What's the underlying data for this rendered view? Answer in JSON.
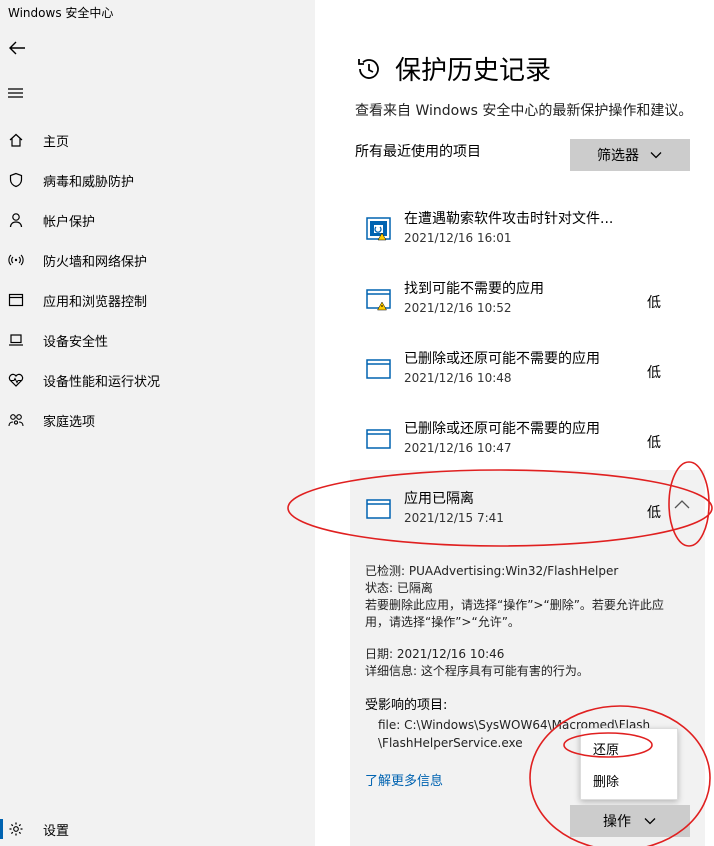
{
  "window": {
    "title": "Windows 安全中心"
  },
  "sidebar": {
    "items": [
      {
        "label": "主页",
        "icon": "home-icon"
      },
      {
        "label": "病毒和威胁防护",
        "icon": "shield-icon"
      },
      {
        "label": "帐户保护",
        "icon": "person-icon"
      },
      {
        "label": "防火墙和网络保护",
        "icon": "wifi-icon"
      },
      {
        "label": "应用和浏览器控制",
        "icon": "app-window-icon"
      },
      {
        "label": "设备安全性",
        "icon": "laptop-icon"
      },
      {
        "label": "设备性能和运行状况",
        "icon": "heart-icon"
      },
      {
        "label": "家庭选项",
        "icon": "family-icon"
      }
    ],
    "settings_label": "设置"
  },
  "main": {
    "title": "保护历史记录",
    "description": "查看来自 Windows 安全中心的最新保护操作和建议。",
    "recent_label": "所有最近使用的项目",
    "filter_label": "筛选器",
    "history": [
      {
        "title": "在遭遇勒索软件攻击时针对文件...",
        "date": "2021/12/16 16:01",
        "severity": ""
      },
      {
        "title": "找到可能不需要的应用",
        "date": "2021/12/16 10:52",
        "severity": "低"
      },
      {
        "title": "已删除或还原可能不需要的应用",
        "date": "2021/12/16 10:48",
        "severity": "低"
      },
      {
        "title": "已删除或还原可能不需要的应用",
        "date": "2021/12/16 10:47",
        "severity": "低"
      },
      {
        "title": "应用已隔离",
        "date": "2021/12/15 7:41",
        "severity": "低"
      }
    ],
    "details": {
      "detected": "已检测: PUAAdvertising:Win32/FlashHelper",
      "status": "状态: 已隔离",
      "instruction_1": "若要删除此应用，请选择“操作”>“删除”。若要允许此应",
      "instruction_2": "用，请选择“操作”>“允许”。",
      "date": "日期:  2021/12/16 10:46",
      "info": "详细信息: 这个程序具有可能有害的行为。",
      "affected_label": "受影响的项目:",
      "file_1": "file: C:\\Windows\\SysWOW64\\Macromed\\Flash",
      "file_2": "\\FlashHelperService.exe",
      "learn_more": "了解更多信息"
    },
    "action_menu": {
      "restore": "还原",
      "delete": "删除"
    },
    "action_label": "操作"
  },
  "colors": {
    "accent": "#0063b1",
    "warning": "#ffcc00",
    "annotation": "#e02020"
  }
}
